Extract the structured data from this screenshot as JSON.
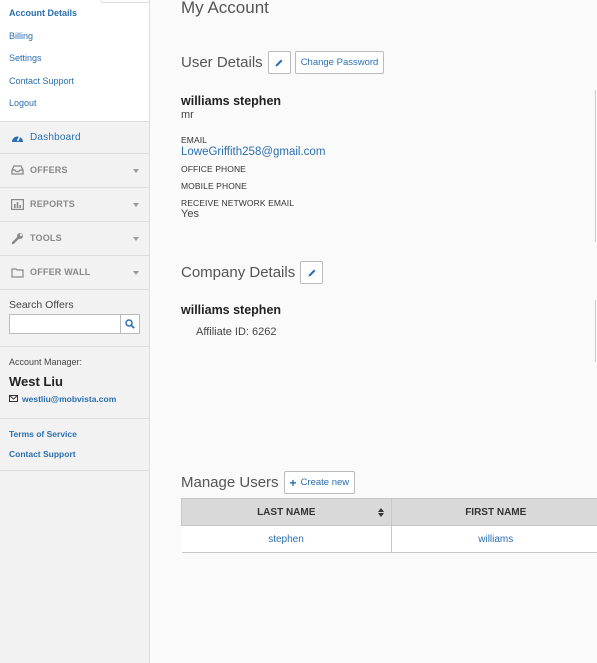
{
  "sidebar": {
    "submenu": [
      "Account Details",
      "Billing",
      "Settings",
      "Contact Support",
      "Logout"
    ],
    "dashboard": "Dashboard",
    "nav": [
      {
        "label": "OFFERS",
        "icon": "inbox-icon"
      },
      {
        "label": "REPORTS",
        "icon": "bar-chart-icon"
      },
      {
        "label": "TOOLS",
        "icon": "wrench-icon"
      },
      {
        "label": "OFFER WALL",
        "icon": "folder-icon"
      }
    ],
    "search": {
      "title": "Search Offers",
      "placeholder": ""
    },
    "manager": {
      "caption": "Account Manager:",
      "name": "West Liu",
      "email": "westliu@mobvista.com"
    },
    "footer": [
      "Terms of Service",
      "Contact Support"
    ]
  },
  "main": {
    "title": "My Account",
    "user_details": {
      "heading": "User Details",
      "change_password": "Change Password",
      "name": "williams stephen",
      "salutation": "mr",
      "email_label": "EMAIL",
      "email": "LoweGriffith258@gmail.com",
      "office_phone_label": "OFFICE PHONE",
      "mobile_phone_label": "MOBILE PHONE",
      "network_email_label": "RECEIVE NETWORK EMAIL",
      "network_email_value": "Yes"
    },
    "company_details": {
      "heading": "Company Details",
      "name": "williams stephen",
      "affiliate": "Affiliate ID: 6262"
    },
    "manage_users": {
      "heading": "Manage Users",
      "create": "Create new",
      "columns": [
        "LAST NAME",
        "FIRST NAME"
      ],
      "rows": [
        [
          "stephen",
          "williams"
        ]
      ]
    }
  },
  "colors": {
    "link": "#2a6fb0",
    "sidebar_bg": "#f2f2f2",
    "header_bg": "#d9d9d9"
  }
}
